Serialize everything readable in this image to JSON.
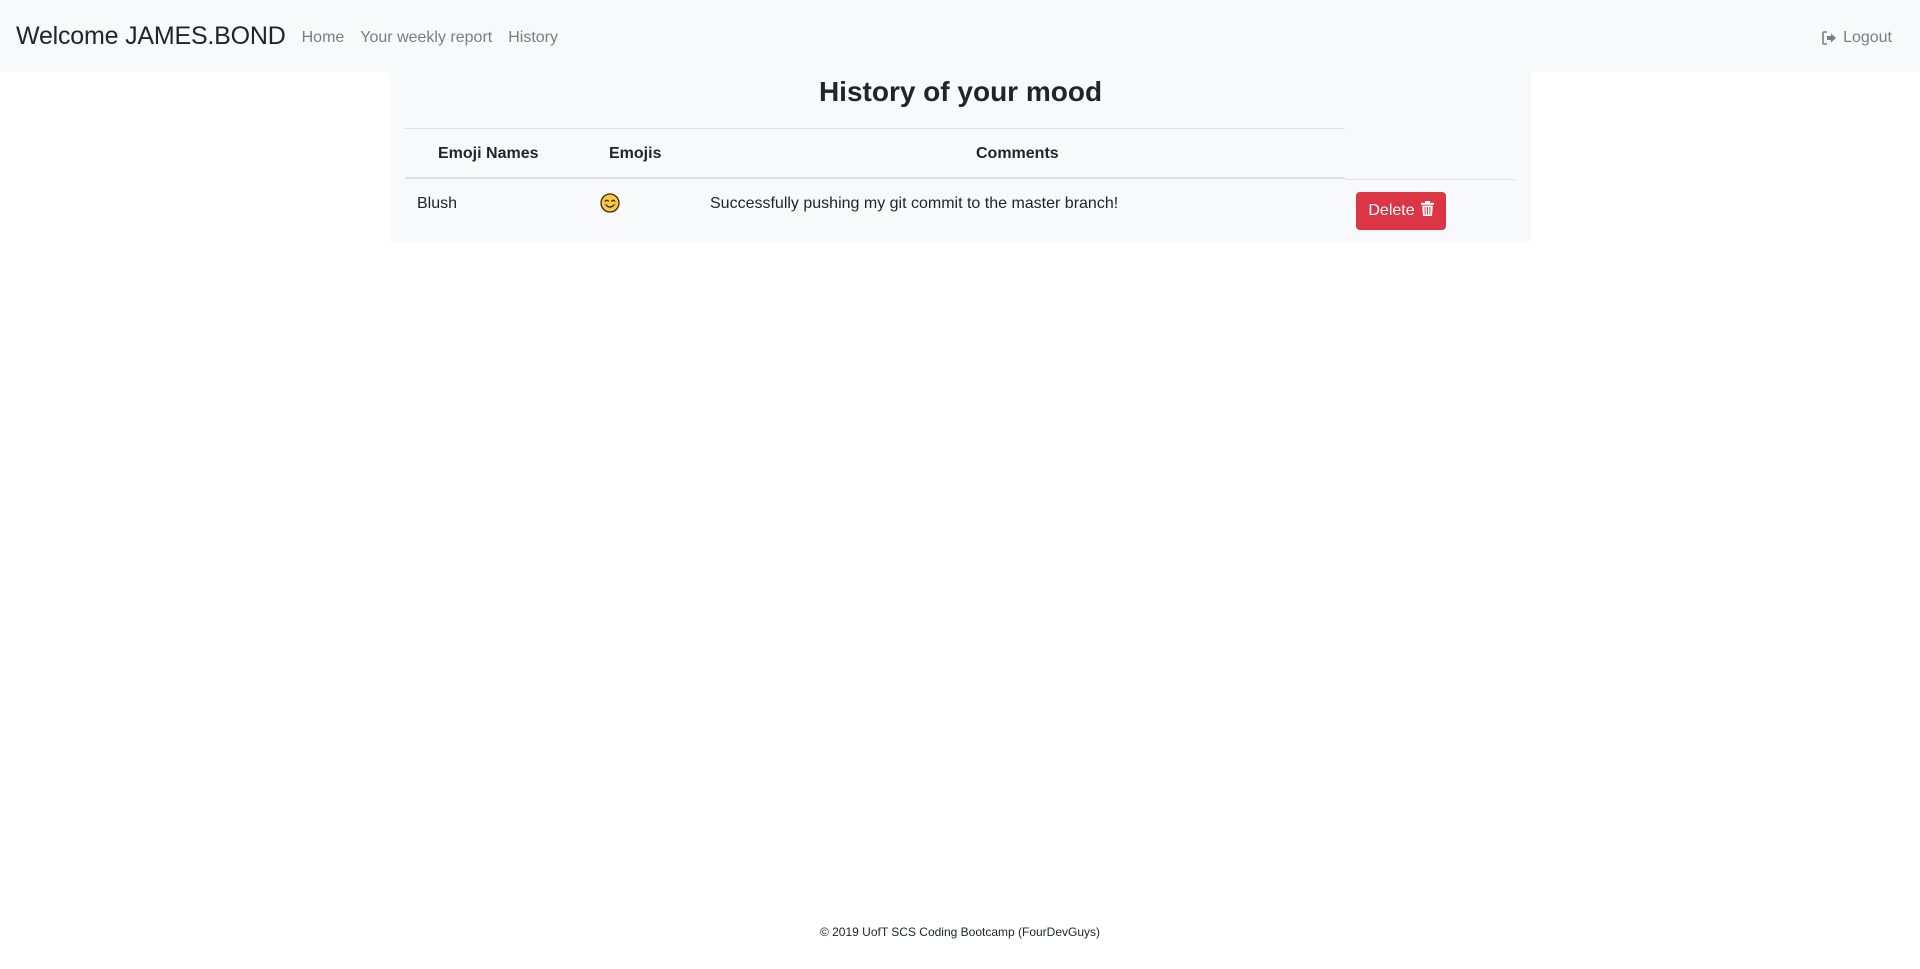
{
  "navbar": {
    "brand": "Welcome JAMES.BOND",
    "links": [
      "Home",
      "Your weekly report",
      "History"
    ],
    "logout_label": "Logout",
    "logout_icon": "sign-out-icon"
  },
  "page": {
    "title": "History of your mood"
  },
  "table": {
    "columns": [
      "Emoji Names",
      "Emojis",
      "Comments"
    ],
    "rows": [
      {
        "emoji_name": "Blush",
        "emoji_icon": "blush-face-icon",
        "comment": "Successfully pushing my git commit to the master branch!",
        "delete_label": "Delete",
        "delete_icon": "trash-icon"
      }
    ]
  },
  "colors": {
    "navbar_bg": "#f8f9fa",
    "danger": "#dc3545",
    "muted_link": "#7a7d80"
  },
  "footer": {
    "text": "© 2019 UofT SCS Coding Bootcamp (FourDevGuys)"
  }
}
